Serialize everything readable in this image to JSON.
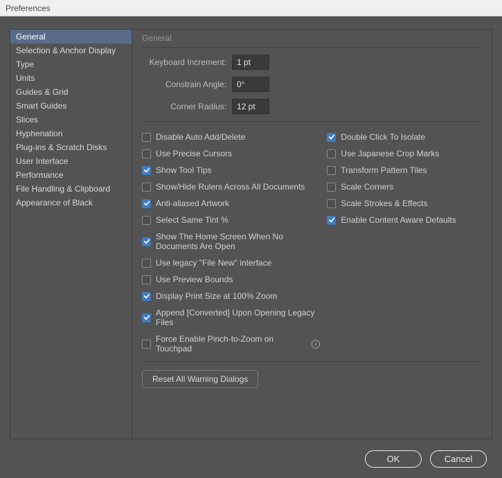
{
  "window": {
    "title": "Preferences"
  },
  "sidebar": {
    "items": [
      "General",
      "Selection & Anchor Display",
      "Type",
      "Units",
      "Guides & Grid",
      "Smart Guides",
      "Slices",
      "Hyphenation",
      "Plug-ins & Scratch Disks",
      "User Interface",
      "Performance",
      "File Handling & Clipboard",
      "Appearance of Black"
    ]
  },
  "panel": {
    "title": "General",
    "fields": {
      "keyboard_increment": {
        "label": "Keyboard Increment:",
        "value": "1 pt"
      },
      "constrain_angle": {
        "label": "Constrain Angle:",
        "value": "0°"
      },
      "corner_radius": {
        "label": "Corner Radius:",
        "value": "12 pt"
      }
    },
    "checks_left": [
      {
        "label": "Disable Auto Add/Delete",
        "checked": false
      },
      {
        "label": "Use Precise Cursors",
        "checked": false
      },
      {
        "label": "Show Tool Tips",
        "checked": true
      },
      {
        "label": "Show/Hide Rulers Across All Documents",
        "checked": false
      },
      {
        "label": "Anti-aliased Artwork",
        "checked": true
      },
      {
        "label": "Select Same Tint %",
        "checked": false
      },
      {
        "label": "Show The Home Screen When No Documents Are Open",
        "checked": true
      },
      {
        "label": "Use legacy \"File New\" interface",
        "checked": false
      },
      {
        "label": "Use Preview Bounds",
        "checked": false
      },
      {
        "label": "Display Print Size at 100% Zoom",
        "checked": true
      },
      {
        "label": "Append [Converted] Upon Opening Legacy Files",
        "checked": true
      },
      {
        "label": "Force Enable Pinch-to-Zoom on Touchpad",
        "checked": false,
        "info": true
      }
    ],
    "checks_right": [
      {
        "label": "Double Click To Isolate",
        "checked": true
      },
      {
        "label": "Use Japanese Crop Marks",
        "checked": false
      },
      {
        "label": "Transform Pattern Tiles",
        "checked": false
      },
      {
        "label": "Scale Corners",
        "checked": false
      },
      {
        "label": "Scale Strokes & Effects",
        "checked": false
      },
      {
        "label": "Enable Content Aware Defaults",
        "checked": true
      }
    ],
    "reset_button": "Reset All Warning Dialogs"
  },
  "footer": {
    "ok": "OK",
    "cancel": "Cancel"
  }
}
